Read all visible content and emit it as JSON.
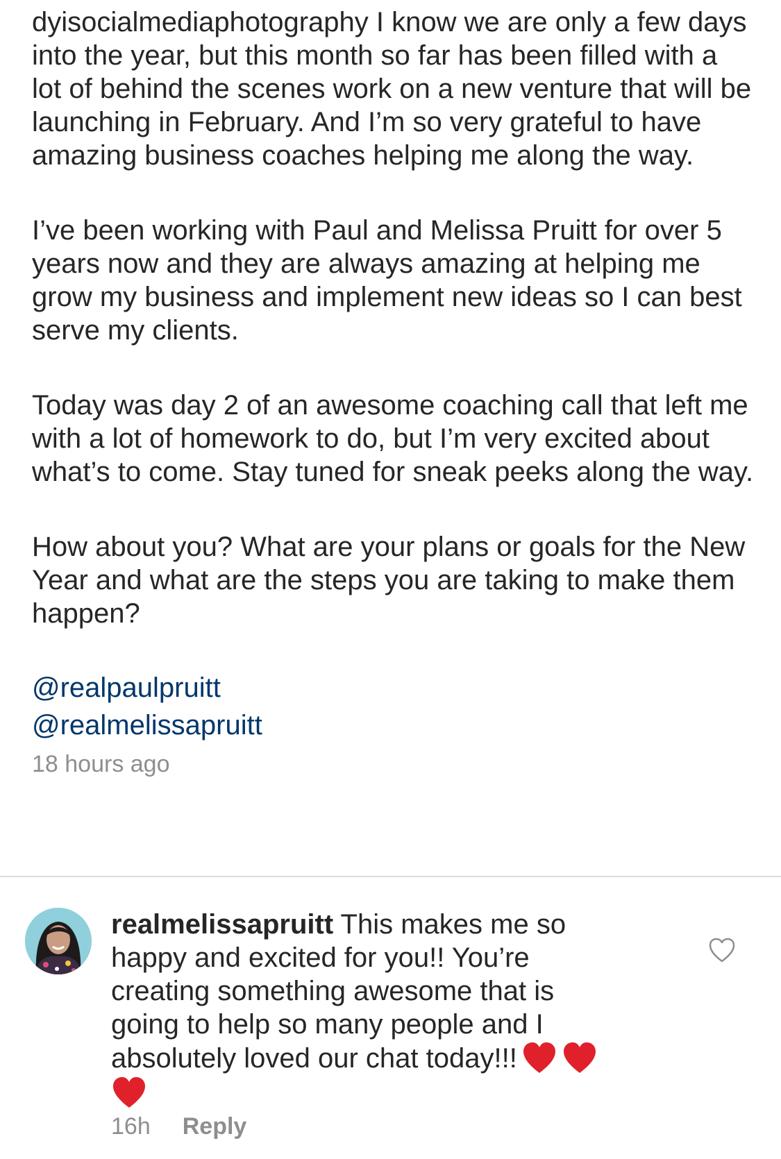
{
  "post": {
    "username": "dyisocialmediaphotography",
    "paragraphs": [
      "I know we are only a few days into the year, but this month so far has been filled with a lot of behind the scenes work on a new venture that will be launching in February. And I’m so very grateful to have amazing business coaches helping me along the way.",
      "I’ve been working with Paul and Melissa Pruitt for over 5 years now and they are always amazing at helping me grow my business and implement new ideas so I can best serve my clients.",
      "Today was day 2 of an awesome coaching call that left me with a lot of homework to do, but I’m very excited about what’s to come. Stay tuned for sneak peeks along the way.",
      "How about you? What are your plans or goals for the New Year and what are the steps you are taking to make them happen?"
    ],
    "mentions": [
      "@realpaulpruitt",
      "@realmelissapruitt"
    ],
    "timestamp": "18 hours ago"
  },
  "comment": {
    "username": "realmelissapruitt",
    "text": "This makes me so happy and excited for you!! You’re creating something awesome that is going to help so many people and I absolutely loved our chat today!!!",
    "age": "16h",
    "reply_label": "Reply",
    "avatar_icon": "profile-photo",
    "like_icon": "heart-outline-icon",
    "emoji": "red-heart-emoji",
    "colors": {
      "heart": "#e0212b",
      "mention": "#00376b",
      "meta": "#8e8e8e"
    }
  }
}
